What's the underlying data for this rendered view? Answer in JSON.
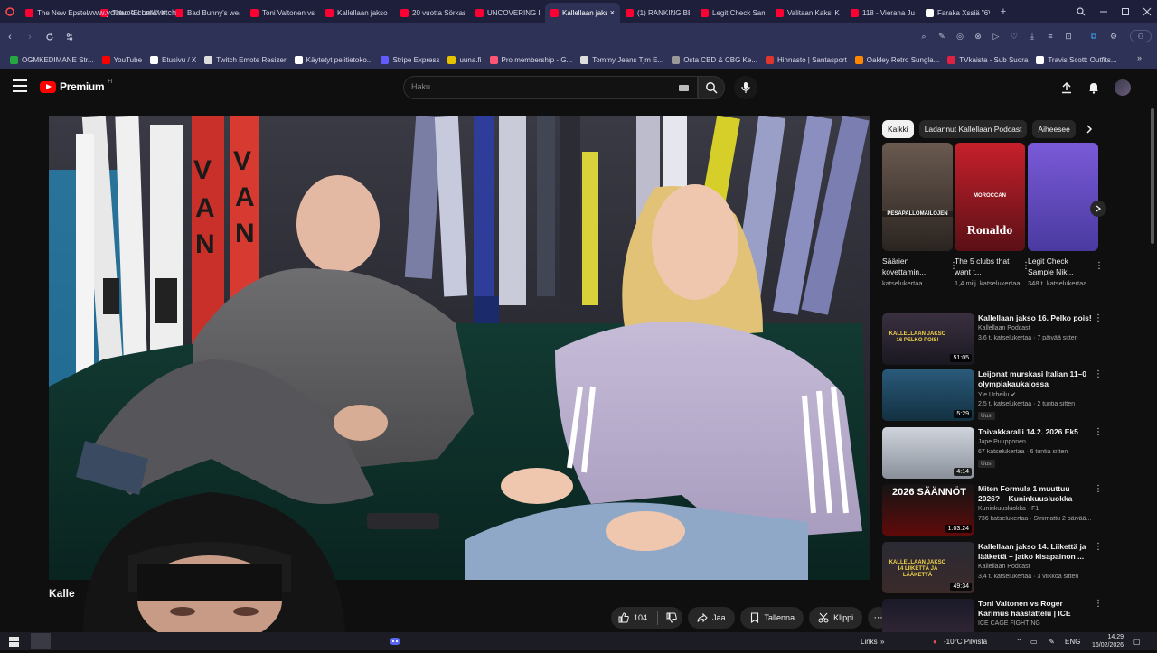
{
  "browser": {
    "tabs": [
      {
        "title": "The New Epstein",
        "color": "#ff0033"
      },
      {
        "title": "Theo \"Ei Leiki\" Ko",
        "color": "#ff0033"
      },
      {
        "title": "Bad Bunny's weal",
        "color": "#ff0033"
      },
      {
        "title": "Toni Valtonen vs R",
        "color": "#ff0033"
      },
      {
        "title": "Kallellaan jakso 1",
        "color": "#ff0033"
      },
      {
        "title": "20 vuotta Sörkas",
        "color": "#ff0033"
      },
      {
        "title": "UNCOVERING DA",
        "color": "#ff0033"
      },
      {
        "title": "Kallellaan jakso 15",
        "color": "#ff0033",
        "active": true
      },
      {
        "title": "(1) RANKING BES",
        "color": "#ff0033"
      },
      {
        "title": "Legit Check Samp",
        "color": "#ff0033"
      },
      {
        "title": "Valitaan Kaksi Kai",
        "color": "#ff0033"
      },
      {
        "title": "118 - Vierana Ju",
        "color": "#ff0033"
      },
      {
        "title": "Faraka Xssiä \"6V",
        "color": "#ffffff"
      }
    ],
    "new_tab": "+",
    "window_controls": [
      "search-tabs",
      "minimize",
      "maximize",
      "close"
    ],
    "url": "www.youtube.com/watch",
    "bookmarks": [
      {
        "label": "OGMKEDIMANE Str...",
        "color": "#26a641"
      },
      {
        "label": "YouTube",
        "color": "#ff0000"
      },
      {
        "label": "Etusivu / X",
        "color": "#ffffff"
      },
      {
        "label": "Twitch Emote Resizer",
        "color": "#dddddd"
      },
      {
        "label": "Käytetyt pelitietoko...",
        "color": "#ffffff"
      },
      {
        "label": "Stripe Express",
        "color": "#635bff"
      },
      {
        "label": "uuna.fi",
        "color": "#e6c200"
      },
      {
        "label": "Pro membership - G...",
        "color": "#ff5577"
      },
      {
        "label": "Tommy Jeans Tjm E...",
        "color": "#dddddd"
      },
      {
        "label": "Osta CBD & CBG Ke...",
        "color": "#999999"
      },
      {
        "label": "Hinnasto | Santasport",
        "color": "#e0342f"
      },
      {
        "label": "Oakley Retro Sungla...",
        "color": "#ff8800"
      },
      {
        "label": "TVkaista - Sub Suora",
        "color": "#dd2244"
      },
      {
        "label": "Travis Scott: Outfits...",
        "color": "#ffffff"
      }
    ]
  },
  "youtube": {
    "logo_text": "Premium",
    "logo_region": "FI",
    "search_placeholder": "Haku",
    "video": {
      "title": "Kalle",
      "likes": "104",
      "share_label": "Jaa",
      "save_label": "Tallenna",
      "clip_label": "Klippi"
    },
    "chips": [
      {
        "label": "Kaikki",
        "active": true
      },
      {
        "label": "Ladannut Kallellaan Podcast",
        "active": false
      },
      {
        "label": "Aiheesee",
        "active": false
      }
    ],
    "shorts": [
      {
        "title": "Säärien kovettamin...",
        "views": "katselukertaa",
        "thumb_text": "PESÄPALLOMAILOJEN"
      },
      {
        "title": "The 5 clubs that want t...",
        "views": "1,4 milj. katselukertaa",
        "thumb_text": "Ronaldo",
        "thumb_top": "MOROCCAN"
      },
      {
        "title": "Legit Check Sample Nik...",
        "views": "348 t. katselukertaa"
      }
    ],
    "recommendations": [
      {
        "title": "Kallellaan jakso 16. Pelko pois!",
        "channel": "Kallellaan Podcast",
        "meta": "3,6 t. katselukertaa · 7 päivää sitten",
        "duration": "51:05",
        "thumb_text": "KALLELLAAN JAKSO 16 PELKO POIS!",
        "verified": false,
        "badge": ""
      },
      {
        "title": "Leijonat murskasi Italian 11–0 olympiakaukalossa",
        "channel": "Yle Urheilu",
        "meta": "2,5 t. katselukertaa · 2 tuntia sitten",
        "duration": "5:29",
        "thumb_text": "",
        "verified": true,
        "badge": "Uusi"
      },
      {
        "title": "Toivakkaralli 14.2. 2026 Ek5",
        "channel": "Jape Puupponen",
        "meta": "67 katselukertaa · 6 tuntia sitten",
        "duration": "4:14",
        "thumb_text": "",
        "verified": false,
        "badge": "Uusi"
      },
      {
        "title": "Miten Formula 1 muuttuu 2026? – Kuninkuusluokka F1-...",
        "channel": "Kuninkuusluokka - F1",
        "meta": "736 katselukertaa · Striimattu 2 päivää...",
        "duration": "1:03:24",
        "thumb_text": "2026 SÄÄNNÖT",
        "verified": false,
        "badge": ""
      },
      {
        "title": "Kallellaan jakso 14. Liikettä ja lääkettä – jatko kisapainon ...",
        "channel": "Kallellaan Podcast",
        "meta": "3,4 t. katselukertaa · 3 viikkoa sitten",
        "duration": "49:34",
        "thumb_text": "KALLELLAAN JAKSO 14 LIIKETTÄ JA LÄÄKETTÄ",
        "verified": false,
        "badge": ""
      },
      {
        "title": "Toni Valtonen vs Roger Karimus haastattelu | ICE CAGE 7",
        "channel": "ICE CAGE FIGHTING",
        "meta": "",
        "duration": "",
        "thumb_text": "",
        "verified": false,
        "badge": ""
      }
    ]
  },
  "taskbar": {
    "links": "Links",
    "weather": "-10°C Pilvistä",
    "lang": "ENG",
    "time": "14.29",
    "date": "16/02/2026"
  }
}
